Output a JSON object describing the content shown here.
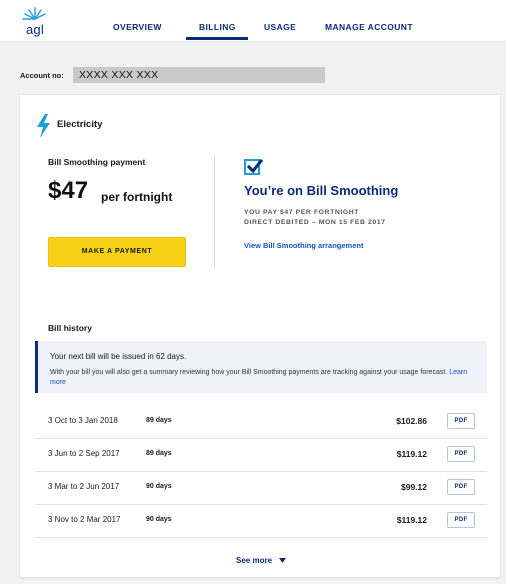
{
  "header": {
    "logo_text": "agl",
    "nav": [
      {
        "label": "OVERVIEW",
        "active": false
      },
      {
        "label": "BILLING",
        "active": true
      },
      {
        "label": "USAGE",
        "active": false
      },
      {
        "label": "MANAGE ACCOUNT",
        "active": false
      }
    ]
  },
  "account": {
    "label": "Account no:",
    "number": "XXXX XXX XXX"
  },
  "electricity": {
    "title": "Electricity",
    "icon": "lightning-bolt-icon"
  },
  "bill_smoothing": {
    "label": "Bill Smoothing payment",
    "amount": "$47",
    "period": "per fortnight",
    "pay_button": "MAKE A PAYMENT",
    "heading": "You’re on Bill Smoothing",
    "line1": "YOU PAY $47 PER FORTNIGHT",
    "line2": "DIRECT DEBITED – MON 15 FEB 2017",
    "link": "View Bill Smoothing arrangement"
  },
  "bill_history": {
    "title": "Bill history",
    "notice_main": "Your next bill will be issued in 62 days.",
    "notice_sub": "With your bill you will also get a summary reviewing how your Bill Smoothing payments are tracking against your usage forecast.",
    "notice_link": "Learn more",
    "rows": [
      {
        "date": "3 Oct to 3 Jan 2018",
        "days": "89 days",
        "amount": "$102.86",
        "pdf": "PDF"
      },
      {
        "date": "3 Jun to 2 Sep 2017",
        "days": "89 days",
        "amount": "$119.12",
        "pdf": "PDF"
      },
      {
        "date": "3 Mar to 2 Jun 2017",
        "days": "90 days",
        "amount": "$99.12",
        "pdf": "PDF"
      },
      {
        "date": "3 Nov to 2 Mar 2017",
        "days": "90 days",
        "amount": "$119.12",
        "pdf": "PDF"
      }
    ],
    "see_more": "See more"
  },
  "colors": {
    "brand_navy": "#0a2a7a",
    "accent_yellow": "#f7d117",
    "accent_cyan": "#1e9fd8",
    "link_blue": "#1254c6"
  }
}
